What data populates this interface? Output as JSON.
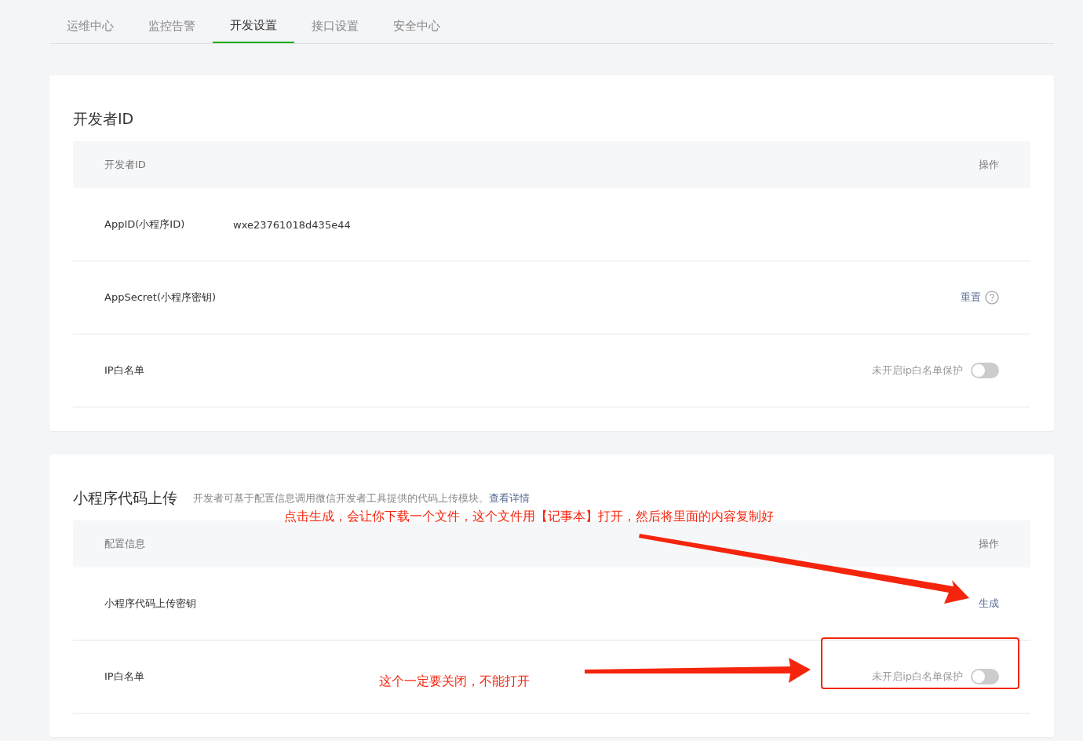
{
  "tabs": [
    {
      "label": "运维中心",
      "selected": false
    },
    {
      "label": "监控告警",
      "selected": false
    },
    {
      "label": "开发设置",
      "selected": true
    },
    {
      "label": "接口设置",
      "selected": false
    },
    {
      "label": "安全中心",
      "selected": false
    }
  ],
  "sections": [
    {
      "title": "开发者ID",
      "header": {
        "name": "开发者ID",
        "action": "操作"
      },
      "rows": [
        {
          "kind": "value",
          "label": "AppID(小程序ID)",
          "value": "wxe23761018d435e44"
        },
        {
          "kind": "link",
          "label": "AppSecret(小程序密钥)",
          "action": "重置",
          "help": true
        },
        {
          "kind": "toggle",
          "label": "IP白名单",
          "status": "未开启ip白名单保护",
          "on": false
        }
      ]
    },
    {
      "title": "小程序代码上传",
      "description": "开发者可基于配置信息调用微信开发者工具提供的代码上传模块。",
      "link": "查看详情",
      "header": {
        "name": "配置信息",
        "action": "操作"
      },
      "rows": [
        {
          "kind": "link",
          "label": "小程序代码上传密钥",
          "action": "生成",
          "help": false
        },
        {
          "kind": "toggle",
          "label": "IP白名单",
          "status": "未开启ip白名单保护",
          "on": false
        }
      ],
      "annotations": [
        "点击生成，会让你下载一个文件，这个文件用【记事本】打开，然后将里面的内容复制好",
        "这个一定要关闭，不能打开"
      ]
    }
  ]
}
